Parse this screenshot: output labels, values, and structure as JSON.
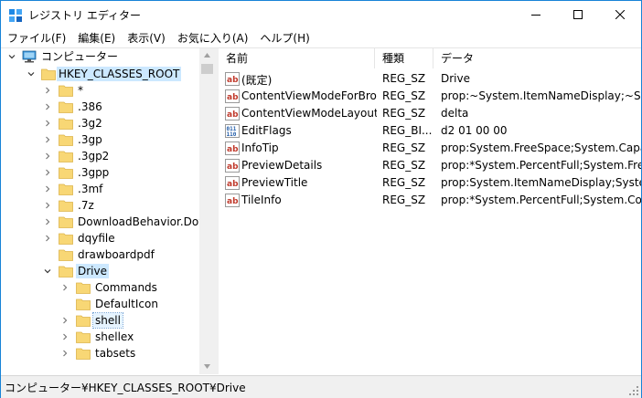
{
  "window": {
    "title": "レジストリ エディター",
    "accent": "#1883d7"
  },
  "menu": [
    "ファイル(F)",
    "編集(E)",
    "表示(V)",
    "お気に入り(A)",
    "ヘルプ(H)"
  ],
  "tree": {
    "root": "コンピューター",
    "hkcr": "HKEY_CLASSES_ROOT",
    "items": [
      "*",
      ".386",
      ".3g2",
      ".3gp",
      ".3gp2",
      ".3gpp",
      ".3mf",
      ".7z",
      "DownloadBehavior.Down",
      "dqyfile",
      "drawboardpdf",
      "Drive"
    ],
    "drive_children": [
      "Commands",
      "DefaultIcon",
      "shell",
      "shellex",
      "tabsets"
    ],
    "selected": "Drive",
    "highlighted_child": "shell"
  },
  "list": {
    "headers": [
      "名前",
      "種類",
      "データ"
    ],
    "rows": [
      {
        "name": "(既定)",
        "type": "REG_SZ",
        "data": "Drive",
        "icon": "string-value-icon"
      },
      {
        "name": "ContentViewModeForBro...",
        "type": "REG_SZ",
        "data": "prop:~System.ItemNameDisplay;~System",
        "icon": "string-value-icon"
      },
      {
        "name": "ContentViewModeLayout...",
        "type": "REG_SZ",
        "data": "delta",
        "icon": "string-value-icon"
      },
      {
        "name": "EditFlags",
        "type": "REG_BI...",
        "data": "d2 01 00 00",
        "icon": "binary-value-icon"
      },
      {
        "name": "InfoTip",
        "type": "REG_SZ",
        "data": "prop:System.FreeSpace;System.Capacity",
        "icon": "string-value-icon"
      },
      {
        "name": "PreviewDetails",
        "type": "REG_SZ",
        "data": "prop:*System.PercentFull;System.FreeSpac",
        "icon": "string-value-icon"
      },
      {
        "name": "PreviewTitle",
        "type": "REG_SZ",
        "data": "prop:System.ItemNameDisplay;System.Ite",
        "icon": "string-value-icon"
      },
      {
        "name": "TileInfo",
        "type": "REG_SZ",
        "data": "prop:*System.PercentFull;System.Comput",
        "icon": "string-value-icon"
      }
    ]
  },
  "status": "コンピューター¥HKEY_CLASSES_ROOT¥Drive"
}
